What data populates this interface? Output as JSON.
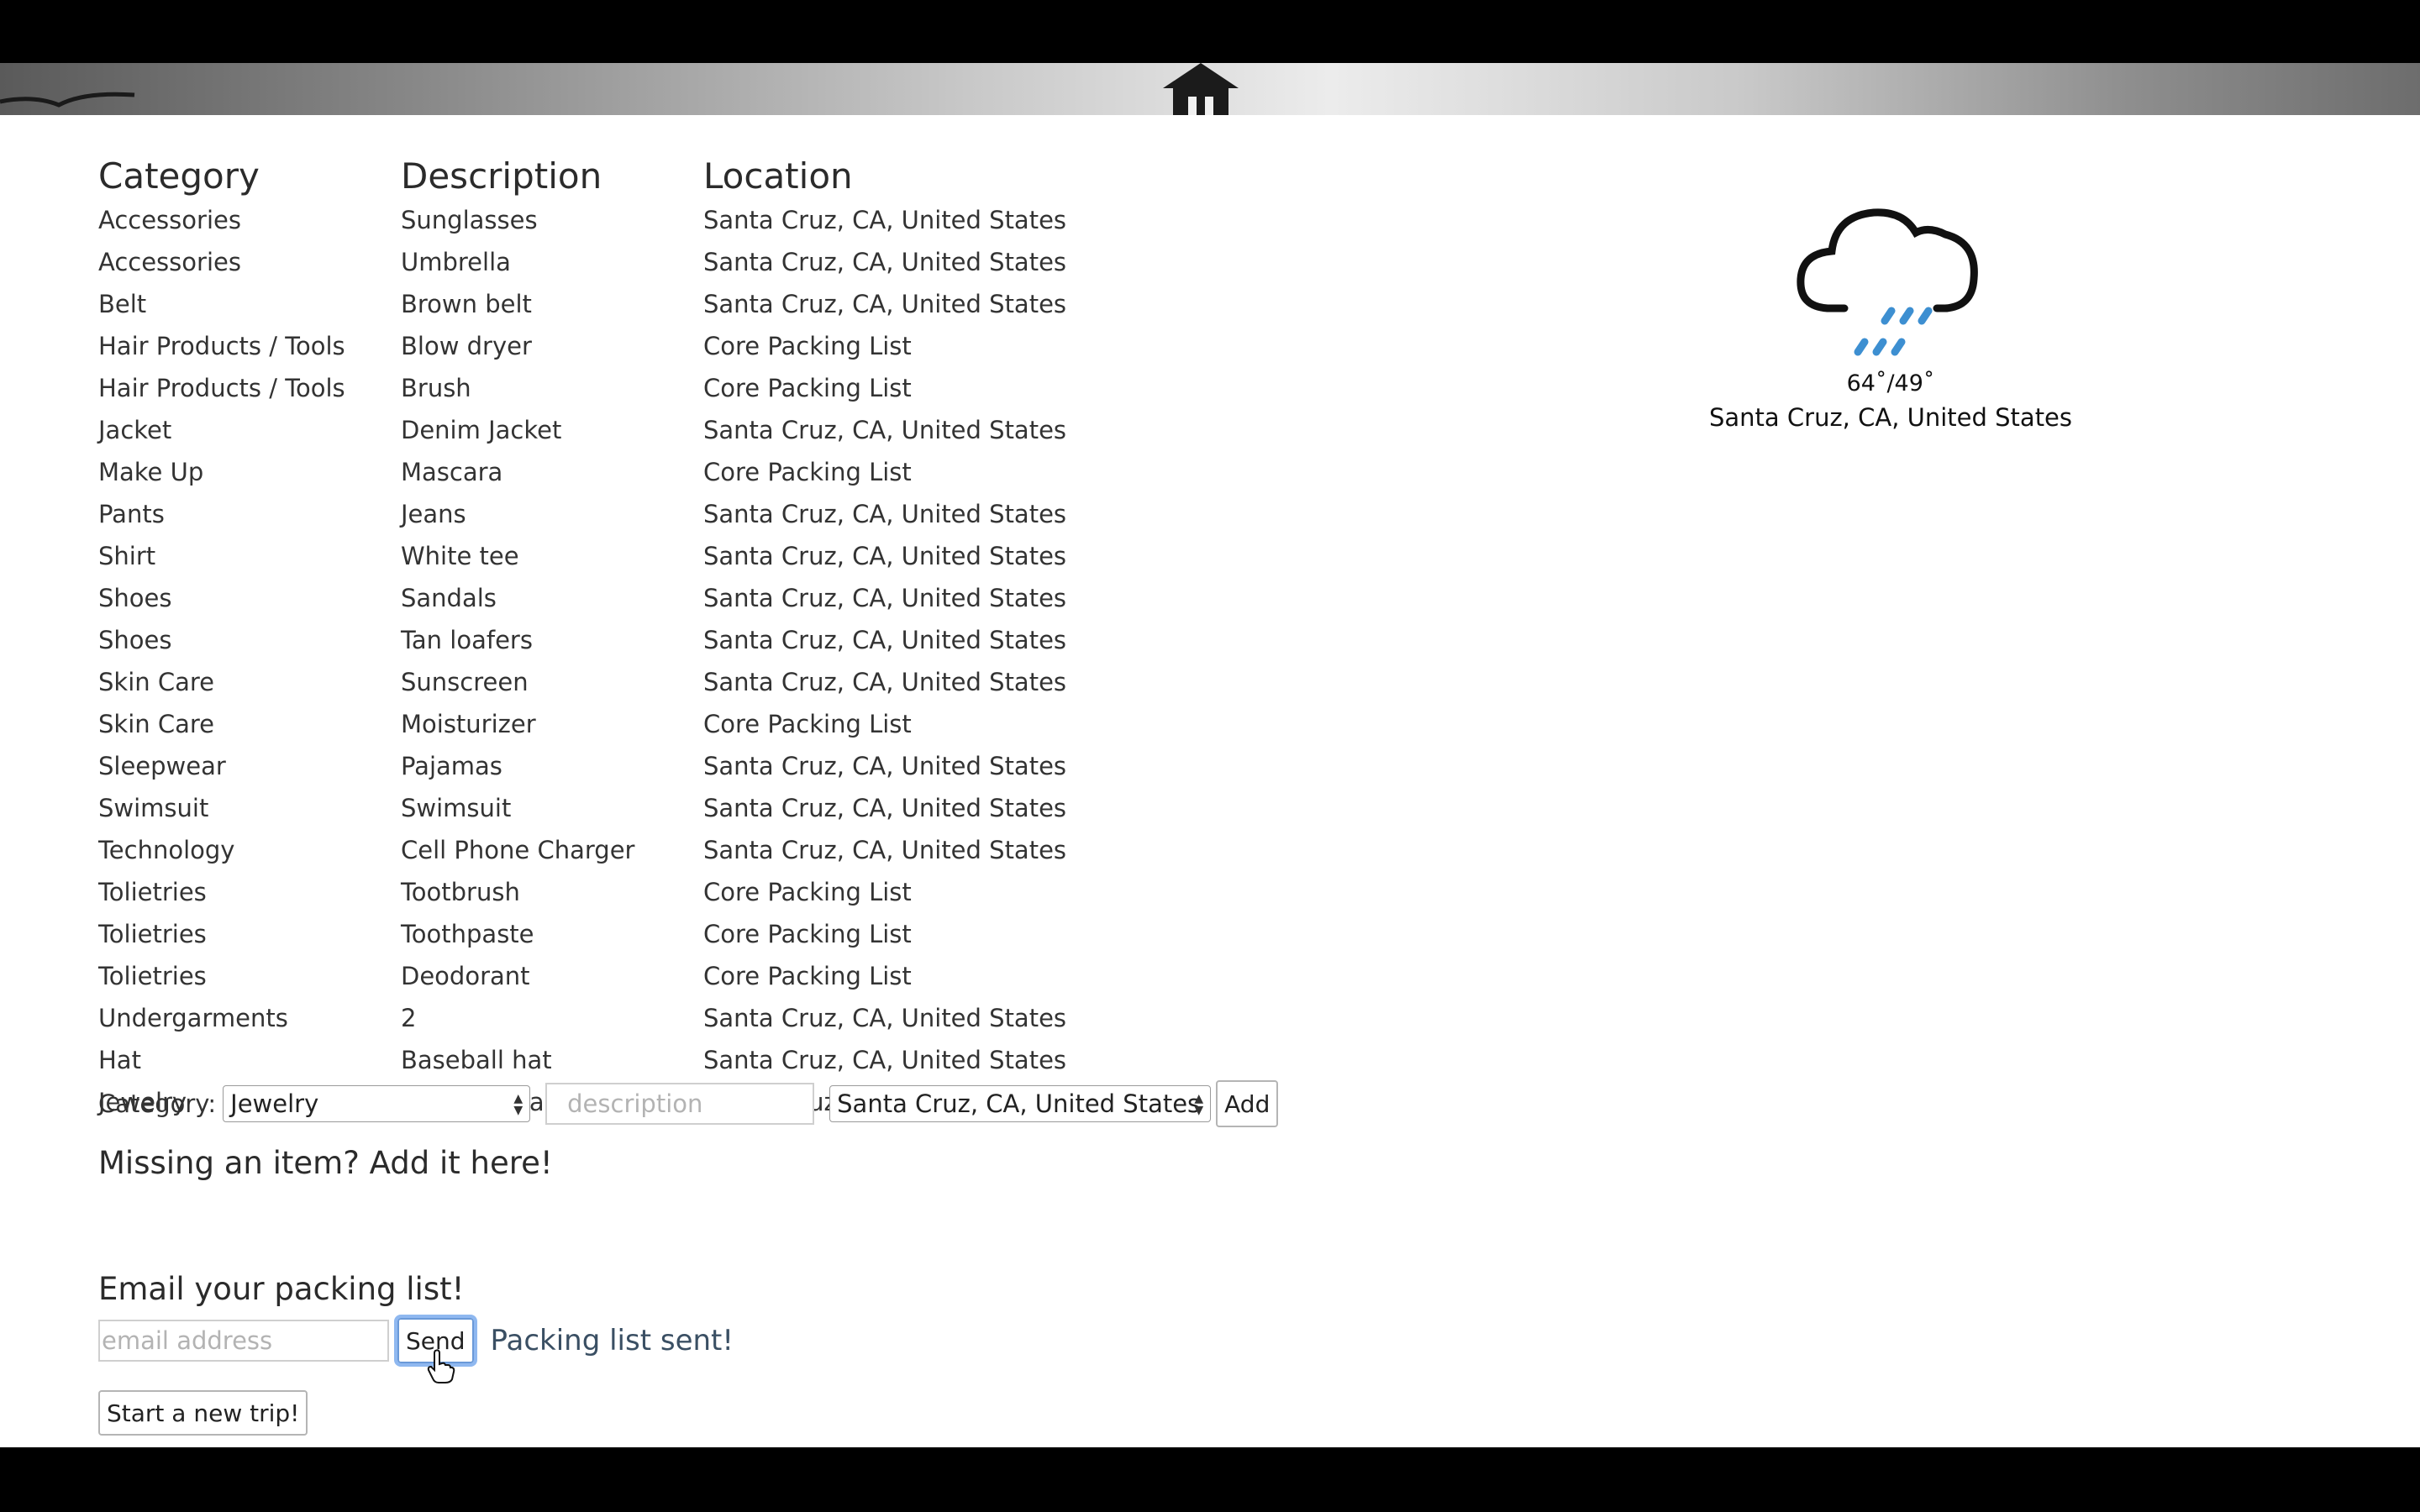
{
  "table": {
    "headers": {
      "category": "Category",
      "description": "Description",
      "location": "Location"
    },
    "rows": [
      {
        "category": "Accessories",
        "description": "Sunglasses",
        "location": "Santa Cruz, CA, United States"
      },
      {
        "category": "Accessories",
        "description": "Umbrella",
        "location": "Santa Cruz, CA, United States"
      },
      {
        "category": "Belt",
        "description": "Brown belt",
        "location": "Santa Cruz, CA, United States"
      },
      {
        "category": "Hair Products / Tools",
        "description": "Blow dryer",
        "location": "Core Packing List"
      },
      {
        "category": "Hair Products / Tools",
        "description": "Brush",
        "location": "Core Packing List"
      },
      {
        "category": "Jacket",
        "description": "Denim Jacket",
        "location": "Santa Cruz, CA, United States"
      },
      {
        "category": "Make Up",
        "description": "Mascara",
        "location": "Core Packing List"
      },
      {
        "category": "Pants",
        "description": "Jeans",
        "location": "Santa Cruz, CA, United States"
      },
      {
        "category": "Shirt",
        "description": "White tee",
        "location": "Santa Cruz, CA, United States"
      },
      {
        "category": "Shoes",
        "description": "Sandals",
        "location": "Santa Cruz, CA, United States"
      },
      {
        "category": "Shoes",
        "description": "Tan loafers",
        "location": "Santa Cruz, CA, United States"
      },
      {
        "category": "Skin Care",
        "description": "Sunscreen",
        "location": "Santa Cruz, CA, United States"
      },
      {
        "category": "Skin Care",
        "description": "Moisturizer",
        "location": "Core Packing List"
      },
      {
        "category": "Sleepwear",
        "description": "Pajamas",
        "location": "Santa Cruz, CA, United States"
      },
      {
        "category": "Swimsuit",
        "description": "Swimsuit",
        "location": "Santa Cruz, CA, United States"
      },
      {
        "category": "Technology",
        "description": "Cell Phone Charger",
        "location": "Santa Cruz, CA, United States"
      },
      {
        "category": "Tolietries",
        "description": "Tootbrush",
        "location": "Core Packing List"
      },
      {
        "category": "Tolietries",
        "description": "Toothpaste",
        "location": "Core Packing List"
      },
      {
        "category": "Tolietries",
        "description": "Deodorant",
        "location": "Core Packing List"
      },
      {
        "category": "Undergarments",
        "description": "2",
        "location": "Santa Cruz, CA, United States"
      },
      {
        "category": "Hat",
        "description": "Baseball hat",
        "location": "Santa Cruz, CA, United States"
      },
      {
        "category": "Jewelry",
        "description": "Gold necklace",
        "location": "Santa Cruz, CA, United States"
      }
    ]
  },
  "weather": {
    "icon": "rain-cloud-icon",
    "temp": "64˚/49˚",
    "location": "Santa Cruz, CA, United States",
    "rain_color": "#3d8fd1"
  },
  "add_item": {
    "heading": "Missing an item? Add it here!",
    "category_label": "Category:",
    "category_value": "Jewelry",
    "description_placeholder": "description",
    "location_value": "Santa Cruz, CA, United States",
    "add_label": "Add"
  },
  "email": {
    "heading": "Email your packing list!",
    "placeholder": "email address",
    "send_label": "Send",
    "status": "Packing list sent!"
  },
  "new_trip_label": "Start a new trip!"
}
